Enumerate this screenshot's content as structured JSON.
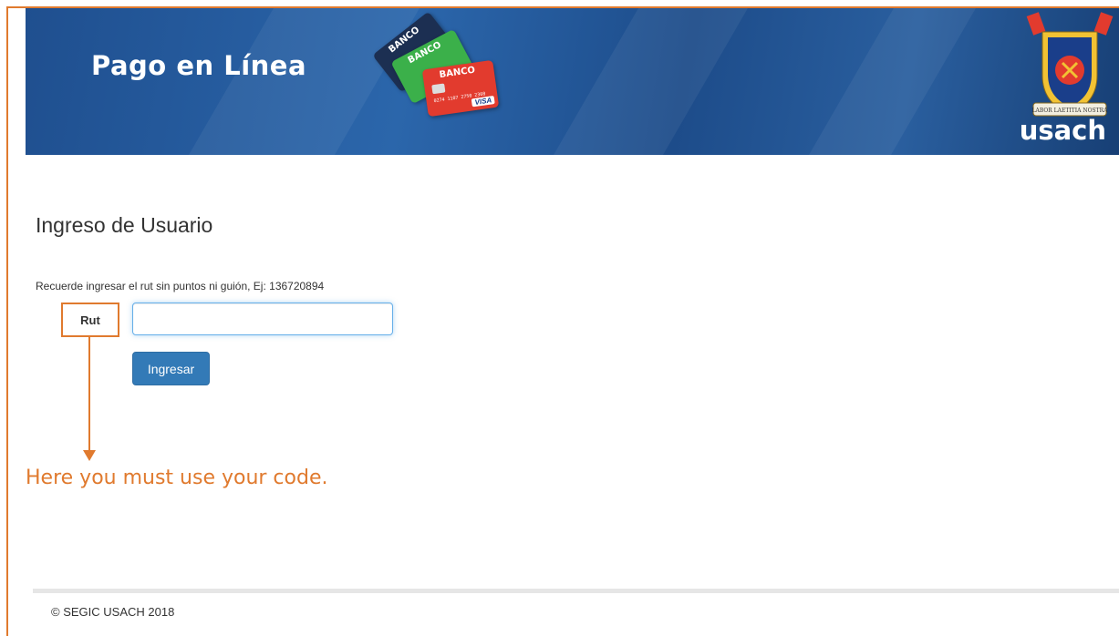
{
  "header": {
    "title": "Pago en Línea",
    "cards": [
      {
        "label": "BANCO",
        "color": "#1c2f52"
      },
      {
        "label": "BANCO",
        "color": "#3bb04a"
      },
      {
        "label": "BANCO",
        "color": "#e23b2e",
        "number": "0274 1107 2750 2308",
        "brand": "VISA"
      }
    ],
    "crest_motto": "LABOR LAETITIA NOSTRA",
    "logo_text": "usach"
  },
  "login": {
    "title": "Ingreso de Usuario",
    "hint": "Recuerde ingresar el rut sin puntos ni guión, Ej: 136720894",
    "rut_label": "Rut",
    "rut_value": "",
    "submit_label": "Ingresar"
  },
  "annotation": {
    "note": "Here you must use your code.",
    "color": "#e07a2e"
  },
  "footer": {
    "copyright": "© SEGIC USACH 2018"
  },
  "colors": {
    "banner": "#1f4f8f",
    "primary_button": "#337ab7"
  }
}
